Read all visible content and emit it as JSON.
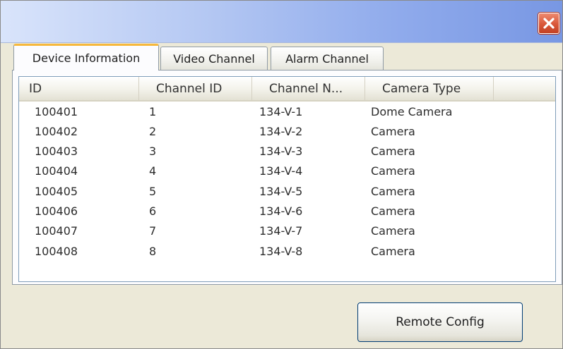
{
  "window": {
    "close_icon": "close-icon",
    "accent_close": "#d9573a"
  },
  "tabs": [
    {
      "label": "Device Information",
      "active": true
    },
    {
      "label": "Video Channel",
      "active": false
    },
    {
      "label": "Alarm Channel",
      "active": false
    }
  ],
  "table": {
    "columns": [
      "ID",
      "Channel ID",
      "Channel N...",
      "Camera Type"
    ],
    "rows": [
      {
        "id": "100401",
        "channel_id": "1",
        "channel_name": "134-V-1",
        "camera_type": "Dome Camera"
      },
      {
        "id": "100402",
        "channel_id": "2",
        "channel_name": "134-V-2",
        "camera_type": "Camera"
      },
      {
        "id": "100403",
        "channel_id": "3",
        "channel_name": "134-V-3",
        "camera_type": "Camera"
      },
      {
        "id": "100404",
        "channel_id": "4",
        "channel_name": "134-V-4",
        "camera_type": "Camera"
      },
      {
        "id": "100405",
        "channel_id": "5",
        "channel_name": "134-V-5",
        "camera_type": "Camera"
      },
      {
        "id": "100406",
        "channel_id": "6",
        "channel_name": "134-V-6",
        "camera_type": "Camera"
      },
      {
        "id": "100407",
        "channel_id": "7",
        "channel_name": "134-V-7",
        "camera_type": "Camera"
      },
      {
        "id": "100408",
        "channel_id": "8",
        "channel_name": "134-V-8",
        "camera_type": "Camera"
      }
    ]
  },
  "footer": {
    "remote_config_label": "Remote Config"
  }
}
